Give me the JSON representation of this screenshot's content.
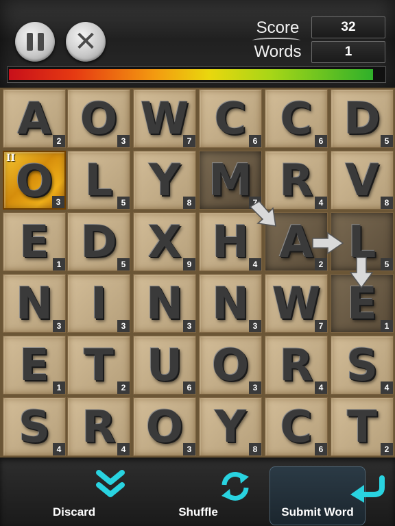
{
  "header": {
    "score_label": "Score",
    "score_value": "32",
    "words_label": "Words",
    "words_value": "1",
    "progress_fraction": 0.97,
    "pause_icon": "pause-icon",
    "close_icon": "close-icon"
  },
  "board": {
    "rows": [
      [
        {
          "l": "A",
          "v": "2"
        },
        {
          "l": "O",
          "v": "3"
        },
        {
          "l": "W",
          "v": "7"
        },
        {
          "l": "C",
          "v": "6"
        },
        {
          "l": "C",
          "v": "6"
        },
        {
          "l": "D",
          "v": "5"
        }
      ],
      [
        {
          "l": "O",
          "v": "3",
          "bonus": "II"
        },
        {
          "l": "L",
          "v": "5"
        },
        {
          "l": "Y",
          "v": "8"
        },
        {
          "l": "M",
          "v": "7",
          "sel": true
        },
        {
          "l": "R",
          "v": "4"
        },
        {
          "l": "V",
          "v": "8"
        }
      ],
      [
        {
          "l": "E",
          "v": "1"
        },
        {
          "l": "D",
          "v": "5"
        },
        {
          "l": "X",
          "v": "9"
        },
        {
          "l": "H",
          "v": "4"
        },
        {
          "l": "A",
          "v": "2",
          "sel": true
        },
        {
          "l": "L",
          "v": "5",
          "sel": true
        }
      ],
      [
        {
          "l": "N",
          "v": "3"
        },
        {
          "l": "I",
          "v": "3"
        },
        {
          "l": "N",
          "v": "3"
        },
        {
          "l": "N",
          "v": "3"
        },
        {
          "l": "W",
          "v": "7"
        },
        {
          "l": "E",
          "v": "1",
          "sel": true
        }
      ],
      [
        {
          "l": "E",
          "v": "1"
        },
        {
          "l": "T",
          "v": "2"
        },
        {
          "l": "U",
          "v": "6"
        },
        {
          "l": "O",
          "v": "3"
        },
        {
          "l": "R",
          "v": "4"
        },
        {
          "l": "S",
          "v": "4"
        }
      ],
      [
        {
          "l": "S",
          "v": "4"
        },
        {
          "l": "R",
          "v": "4"
        },
        {
          "l": "O",
          "v": "3"
        },
        {
          "l": "Y",
          "v": "8"
        },
        {
          "l": "C",
          "v": "6"
        },
        {
          "l": "T",
          "v": "2"
        }
      ]
    ]
  },
  "actions": {
    "discard_label": "Discard",
    "shuffle_label": "Shuffle",
    "submit_label": "Submit Word",
    "accent_color": "#29d3e0"
  }
}
